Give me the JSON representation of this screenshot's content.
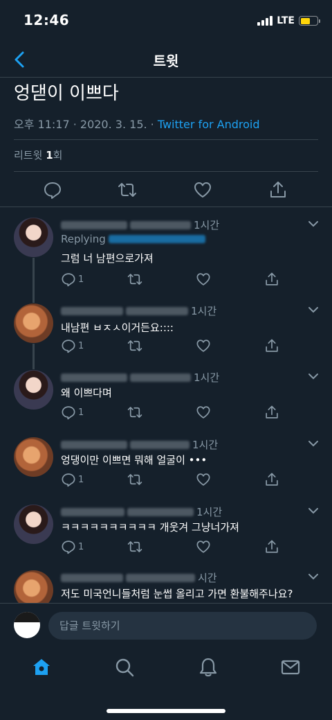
{
  "status": {
    "time": "12:46",
    "network": "LTE"
  },
  "nav": {
    "title": "트윗"
  },
  "tweet": {
    "text": "엉댇이 이쁘다",
    "meta_prefix": "오후 11:17 · 2020. 3. 15. · ",
    "source": "Twitter for Android",
    "retweets_label": "리트윗",
    "retweets_count": "1",
    "retweets_unit": "회"
  },
  "replies": [
    {
      "time": "1시간",
      "replying": "Replying",
      "text": "그럼 너 남편으로가져",
      "reply_count": "1"
    },
    {
      "time": "1시간",
      "text": "내남편 ㅂㅈㅅ이거든요::::",
      "reply_count": "1"
    },
    {
      "time": "1시간",
      "text": "왜 이쁘다며",
      "reply_count": "1"
    },
    {
      "time": "1시간",
      "text": "엉댕이만 이쁘면 뭐해 얼굴이 •••",
      "reply_count": "1"
    },
    {
      "time": "1시간",
      "text": "ㅋㅋㅋㅋㅋㅋㅋㅋㅋㅋ 개웃겨 그냥너가져",
      "reply_count": "1"
    },
    {
      "time": "시간",
      "text": "저도 미국언니들처럼 눈썹 올리고 가면 환불해주나요?"
    }
  ],
  "compose": {
    "placeholder": "답글 트윗하기"
  },
  "colors": {
    "background": "#15202b",
    "accent": "#1da1f2",
    "muted": "#8899a6",
    "border": "#38444d"
  }
}
